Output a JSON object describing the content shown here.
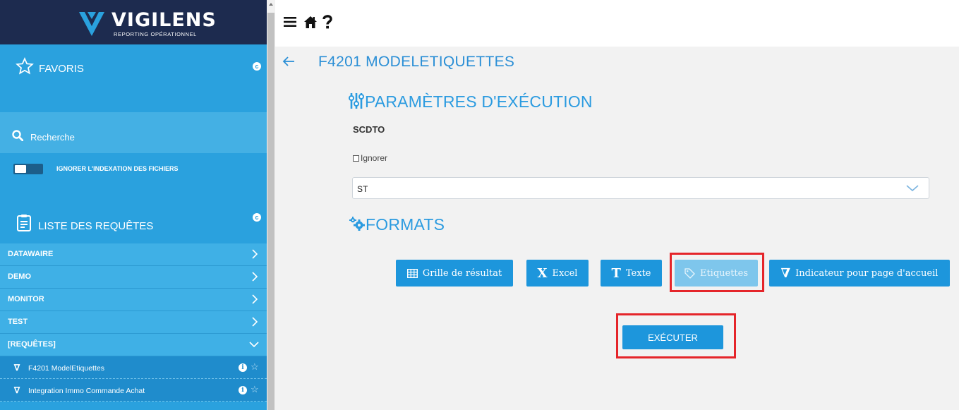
{
  "brand": {
    "name": "VIGILENS",
    "subtitle": "REPORTING OPÉRATIONNEL"
  },
  "sidebar": {
    "favorites_title": "FAVORIS",
    "search_label": "Recherche",
    "toggle_label": "IGNORER L'INDEXATION DES FICHIERS",
    "requests_title": "LISTE DES REQUÊTES",
    "folders": [
      {
        "label": "DATAWAIRE",
        "state": "collapsed"
      },
      {
        "label": "DEMO",
        "state": "collapsed"
      },
      {
        "label": "MONITOR",
        "state": "collapsed"
      },
      {
        "label": "TEST",
        "state": "collapsed"
      },
      {
        "label": "[REQUÊTES]",
        "state": "expanded"
      }
    ],
    "requests": [
      {
        "label": "F4201 ModelEtiquettes"
      },
      {
        "label": "Integration Immo Commande Achat"
      }
    ]
  },
  "topbar": {
    "icons": [
      "menu-icon",
      "home-icon",
      "help-icon"
    ]
  },
  "main": {
    "title": "F4201 MODELETIQUETTES",
    "params_title": "PARAMÈTRES D'EXÉCUTION",
    "field_label": "SCDTO",
    "ignore_label": "Ignorer",
    "select_value": "ST",
    "formats_title": "FORMATS",
    "formats": [
      {
        "label": "Grille de résultat",
        "icon": "grid-icon",
        "enabled": true
      },
      {
        "label": "Excel",
        "icon": "excel-icon",
        "enabled": true
      },
      {
        "label": "Texte",
        "icon": "text-icon",
        "enabled": true
      },
      {
        "label": "Etiquettes",
        "icon": "tag-icon",
        "enabled": false
      },
      {
        "label": "Indicateur pour page d'accueil",
        "icon": "vigilens-icon",
        "enabled": true
      }
    ],
    "execute_label": "EXÉCUTER"
  },
  "colors": {
    "sidebar": "#2aa1de",
    "brand_bg": "#1d2b4f",
    "accent": "#1d96dc",
    "highlight": "#e5252a"
  }
}
